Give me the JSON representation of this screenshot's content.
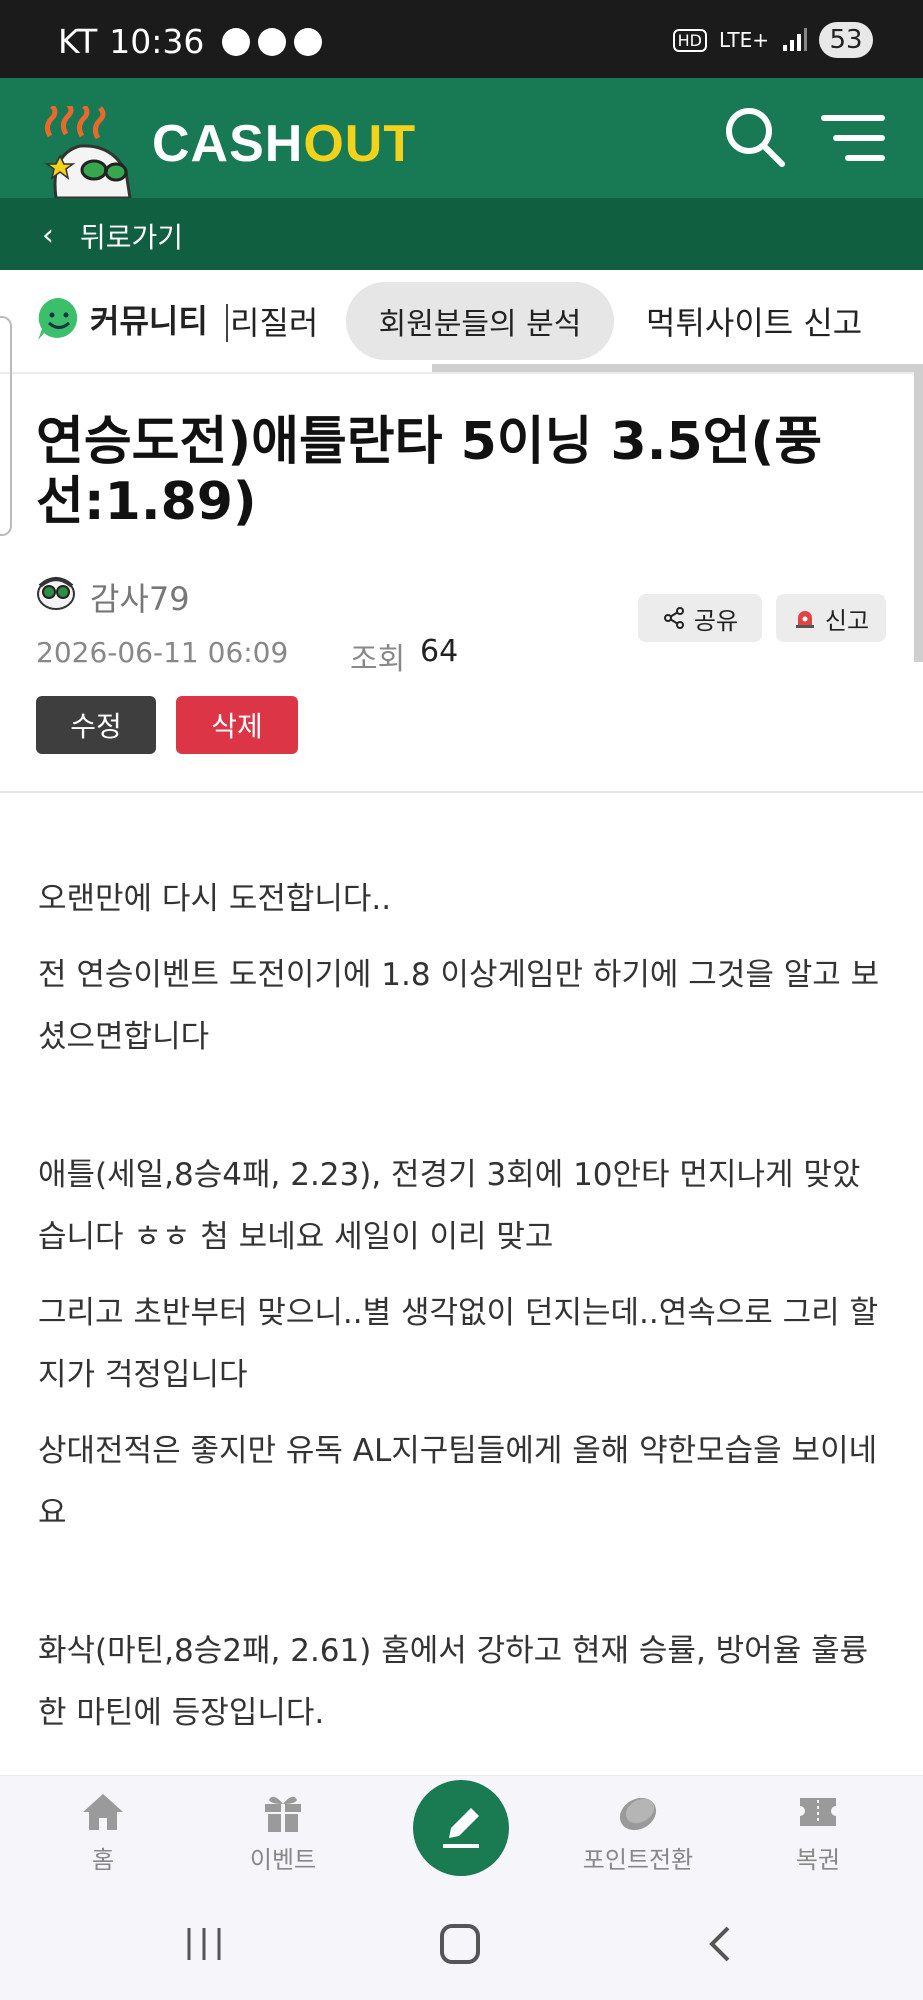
{
  "status_bar": {
    "carrier": "KT",
    "time": "10:36",
    "network": "LTE+",
    "hd": "HD",
    "battery": "53"
  },
  "header": {
    "logo_cash": "CASH",
    "logo_out": "OUT",
    "brand_color": "#187a54"
  },
  "back": {
    "label": "뒤로가기"
  },
  "tabs": {
    "community": "커뮤니티",
    "items": [
      "리질러",
      "회원분들의 분석",
      "먹튀사이트 신고"
    ],
    "active_index": 1
  },
  "post": {
    "title": "연승도전)애틀란타 5이닝 3.5언(풍선:1.89)",
    "author": "감사79",
    "date": "2026-06-11 06:09",
    "views_label": "조회",
    "views": "64",
    "share_label": "공유",
    "report_label": "신고",
    "edit_label": "수정",
    "delete_label": "삭제",
    "paragraphs": [
      "오랜만에 다시 도전합니다..",
      "전 연승이벤트 도전이기에 1.8 이상게임만 하기에 그것을 알고 보셨으면합니다",
      "",
      "애틀(세일,8승4패, 2.23), 전경기 3회에 10안타 먼지나게 맞았습니다 ㅎㅎ 첨 보네요 세일이 이리 맞고",
      "그리고 초반부터 맞으니..별 생각없이 던지는데..연속으로 그리 할지가 걱정입니다",
      "상대전적은 좋지만 유독 AL지구팀들에게 올해 약한모습을 보이네요",
      "",
      "화삭(마틴,8승2패, 2.61) 홈에서 강하고 현재 승률, 방어율 훌륭한 마틴에 등장입니다."
    ]
  },
  "bottom_nav": {
    "items": [
      {
        "label": "홈",
        "icon": "home-icon"
      },
      {
        "label": "이벤트",
        "icon": "gift-icon"
      },
      {
        "label": "포인트전환",
        "icon": "coin-icon"
      },
      {
        "label": "복권",
        "icon": "ticket-icon"
      }
    ],
    "fab_icon": "pencil-icon"
  }
}
